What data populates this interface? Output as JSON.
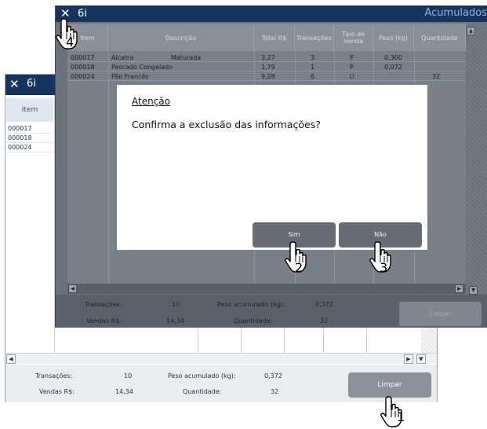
{
  "back_window": {
    "close_glyph": "✕",
    "title": "6i",
    "column_header_item": "Item",
    "items": [
      "000017",
      "000018",
      "000024"
    ],
    "footer": {
      "transacoes_label": "Transações:",
      "transacoes_value": "10",
      "peso_label": "Peso acumulado (kg):",
      "peso_value": "0,372",
      "vendas_label": "Vendas R$:",
      "vendas_value": "14,34",
      "quantidade_label": "Quantidade:",
      "quantidade_value": "32"
    },
    "limpar_label": "Limpar"
  },
  "front_window": {
    "close_glyph": "✕",
    "title": "6i",
    "app_title": "Acumulados",
    "columns": [
      "Item",
      "Descrição",
      "Total R$",
      "Transações",
      "Tipo de venda",
      "Peso (kg)",
      "Quantidade"
    ],
    "rows": [
      {
        "item": "000017",
        "descricao": "Alcatra",
        "descricao2": "Maturada",
        "total": "3,27",
        "transacoes": "3",
        "tipo": "P",
        "peso": "0,300",
        "quantidade": ""
      },
      {
        "item": "000018",
        "descricao": "Pescado Congelado",
        "descricao2": "",
        "total": "1,79",
        "transacoes": "1",
        "tipo": "P",
        "peso": "0,072",
        "quantidade": ""
      },
      {
        "item": "000024",
        "descricao": "Pão Francês",
        "descricao2": "",
        "total": "9,28",
        "transacoes": "6",
        "tipo": "U",
        "peso": "",
        "quantidade": "32"
      }
    ],
    "footer": {
      "transacoes_label": "Transações:",
      "transacoes_value": "10",
      "peso_label": "Peso acumulado (kg):",
      "peso_value": "0,372",
      "vendas_label": "Vendas R$:",
      "vendas_value": "14,34",
      "quantidade_label": "Quantidade:",
      "quantidade_value": "32"
    },
    "limpar_label": "Limpar"
  },
  "dialog": {
    "title": "Atenção",
    "message": "Confirma a exclusão das informações?",
    "yes_label": "Sim",
    "no_label": "Não"
  },
  "steps": [
    "1",
    "2",
    "3",
    "4"
  ],
  "colors": {
    "titlebar": "#17345f",
    "overlay": "#6c727b",
    "button": "#676c74"
  }
}
